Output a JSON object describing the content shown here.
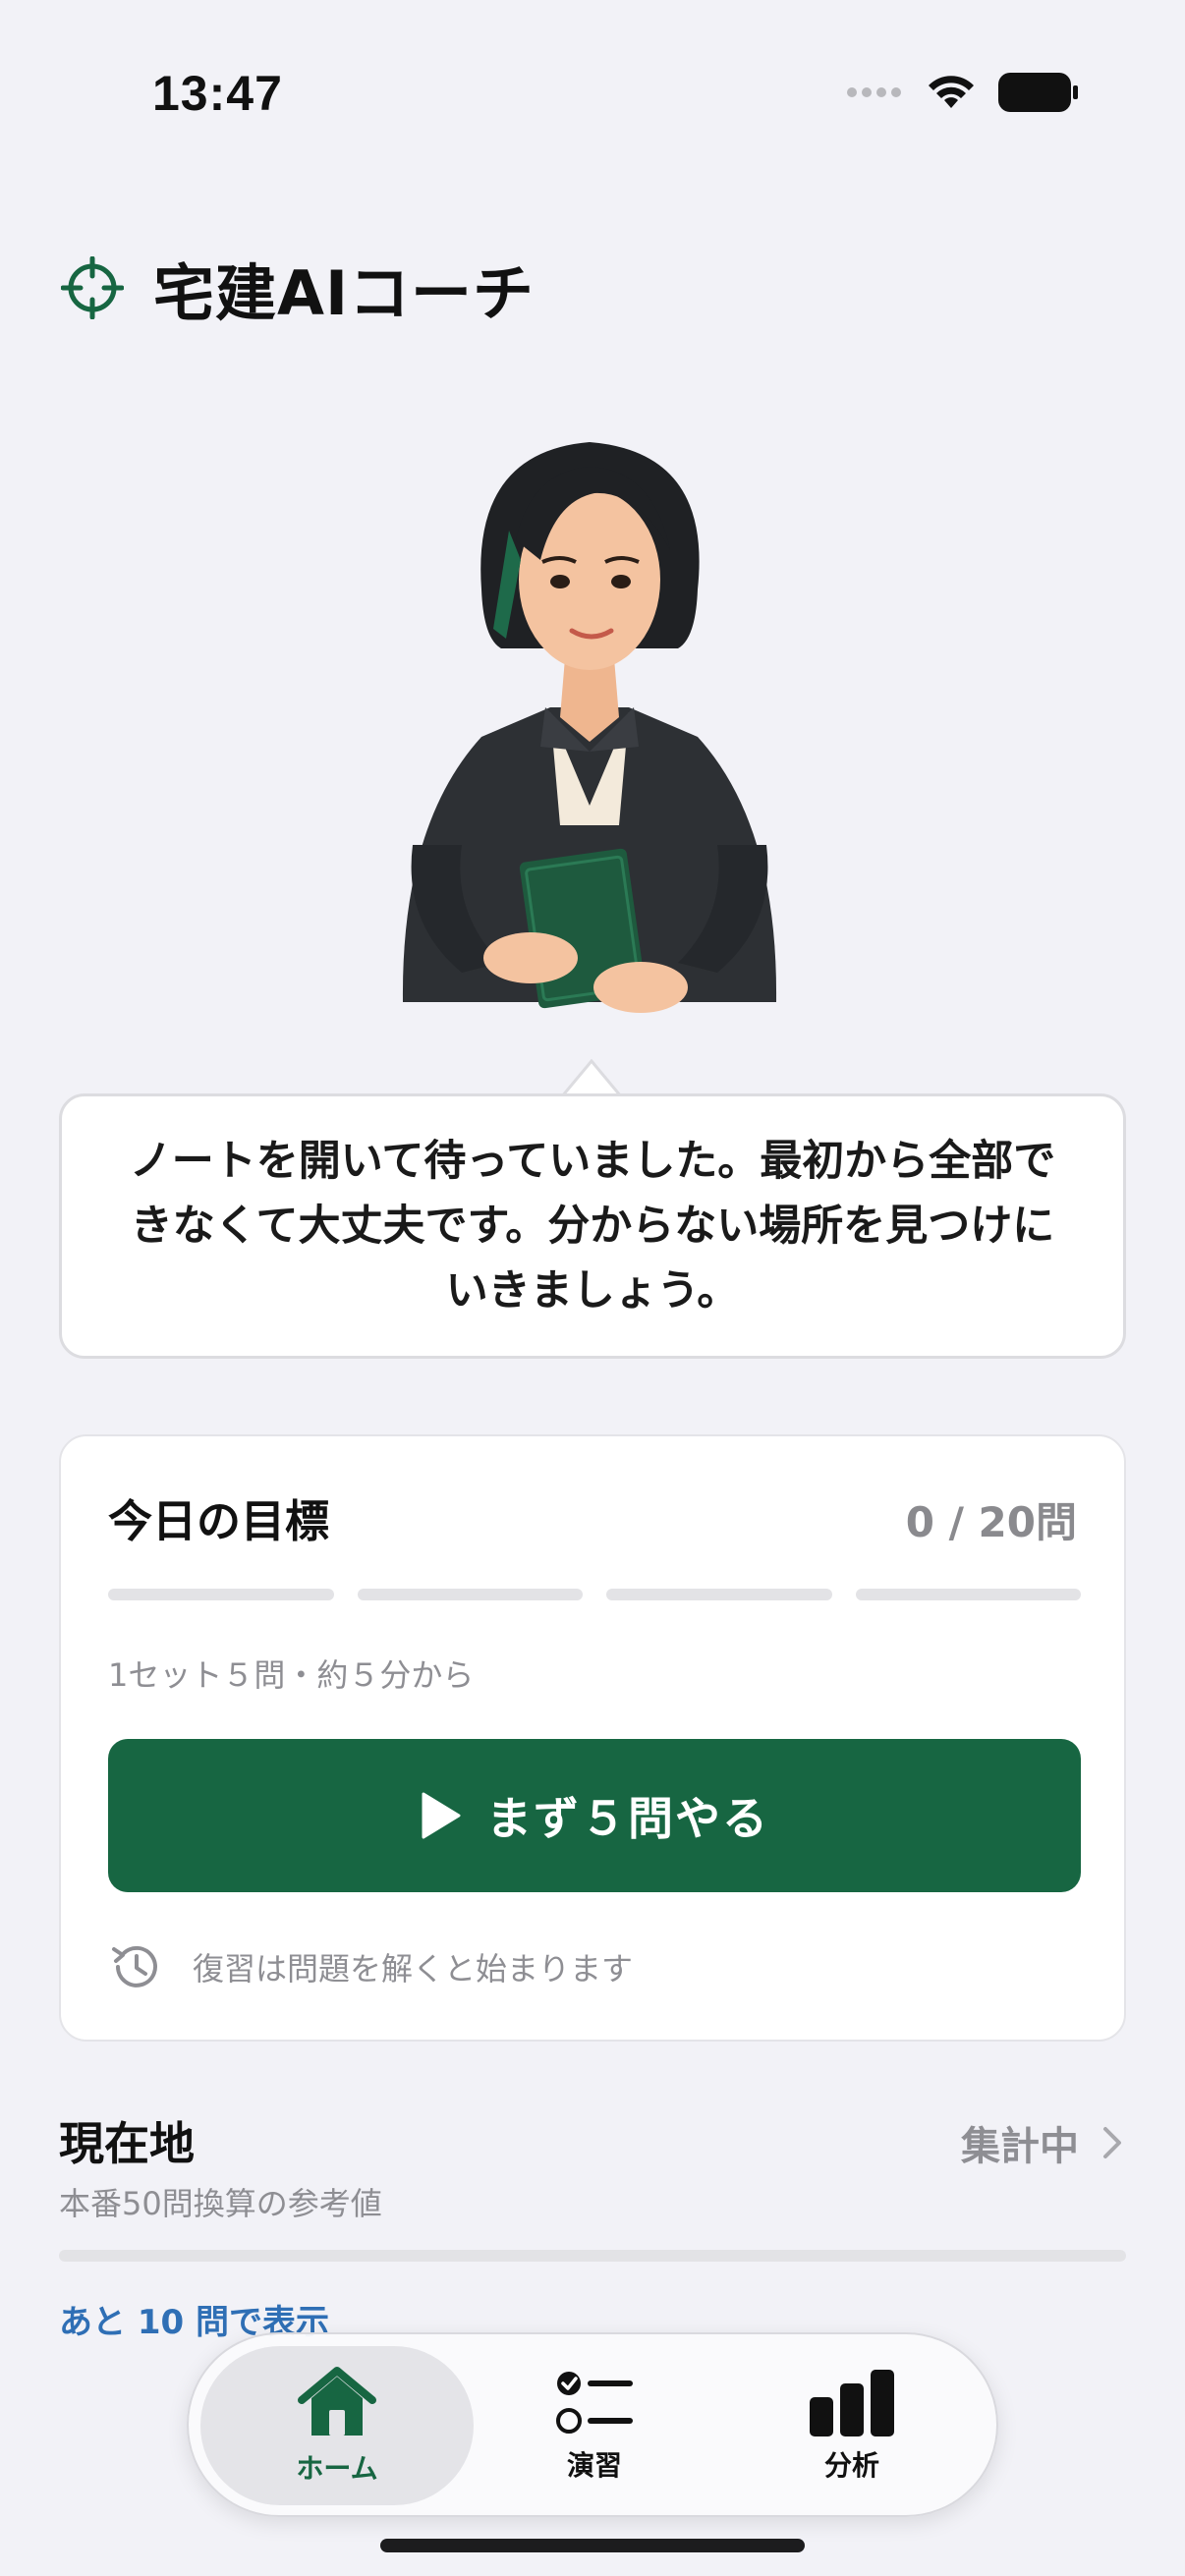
{
  "status_bar": {
    "time": "13:47"
  },
  "header": {
    "title": "宅建AIコーチ"
  },
  "coach": {
    "message": "ノートを開いて待っていました。最初から全部できなくて大丈夫です。分からない場所を見つけにいきましょう。"
  },
  "goal": {
    "title": "今日の目標",
    "count": "0 / 20問",
    "progress_segments_completed": 0,
    "progress_segments_total": 4,
    "subtitle": "1セット５問・約５分から",
    "start_button_label": "まず５問やる",
    "review_text": "復習は問題を解くと始まります"
  },
  "location": {
    "title": "現在地",
    "subtitle": "本番50問換算の参考値",
    "status": "集計中",
    "hint": "あと 10 問で表示"
  },
  "tabbar": {
    "tabs": [
      {
        "label": "ホーム",
        "icon": "house-icon",
        "active": true
      },
      {
        "label": "演習",
        "icon": "checklist-icon",
        "active": false
      },
      {
        "label": "分析",
        "icon": "bar-chart-icon",
        "active": false
      }
    ]
  },
  "colors": {
    "accent": "#176642",
    "link": "#2f6fb5",
    "background": "#f2f2f7"
  }
}
